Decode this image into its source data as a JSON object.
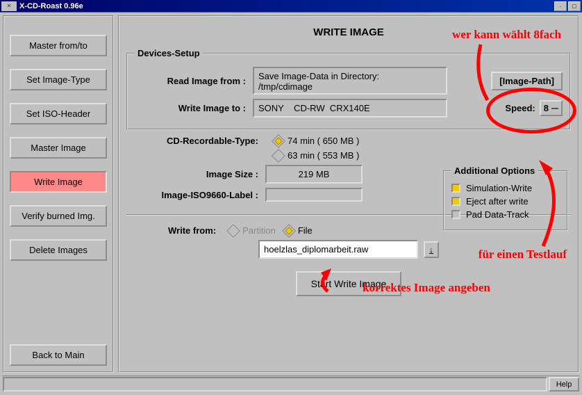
{
  "window": {
    "title": "X-CD-Roast 0.96e"
  },
  "sidebar": {
    "items": [
      "Master from/to",
      "Set Image-Type",
      "Set ISO-Header",
      "Master Image",
      "Write Image",
      "Verify burned Img.",
      "Delete Images",
      "Back to Main"
    ],
    "active": 4
  },
  "heading": "WRITE IMAGE",
  "devices": {
    "legend": "Devices-Setup",
    "read_lbl": "Read Image from :",
    "read_val": "Save Image-Data in Directory:\n/tmp/cdimage",
    "write_lbl": "Write Image to :",
    "write_val": "SONY    CD-RW  CRX140E",
    "imgpath": "[Image-Path]",
    "speed_lbl": "Speed:",
    "speed_val": "8"
  },
  "cdtype": {
    "lbl": "CD-Recordable-Type:",
    "opt1": "74 min ( 650 MB )",
    "opt2": "63 min ( 553 MB )",
    "sel": 0
  },
  "imgsize": {
    "lbl": "Image Size :",
    "val": "219 MB"
  },
  "isolabel": {
    "lbl": "Image-ISO9660-Label :",
    "val": ""
  },
  "addopt": {
    "legend": "Additional Options",
    "o1": "Simulation-Write",
    "o2": "Eject after write",
    "o3": "Pad Data-Track",
    "c1": true,
    "c2": true,
    "c3": false
  },
  "writefrom": {
    "lbl": "Write from:",
    "part": "Partition",
    "file": "File",
    "sel": 1,
    "filename": "hoelzlas_diplomarbeit.raw"
  },
  "start": "Start Write Image",
  "help": "Help",
  "annotations": {
    "a1": "wer kann wählt 8fach",
    "a2": "für einen Testlauf",
    "a3": "korrektes Image angeben"
  }
}
